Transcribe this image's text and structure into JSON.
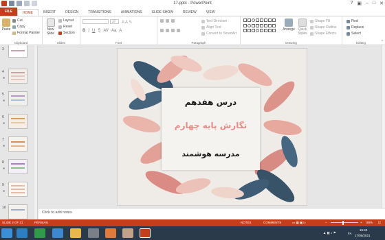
{
  "window": {
    "title": "17.pptx - PowerPoint"
  },
  "tabs": [
    "FILE",
    "HOME",
    "INSERT",
    "DESIGN",
    "TRANSITIONS",
    "ANIMATIONS",
    "SLIDE SHOW",
    "REVIEW",
    "VIEW"
  ],
  "ribbon": {
    "clipboard": {
      "paste": "Paste",
      "cut": "Cut",
      "copy": "Copy",
      "format_painter": "Format Painter",
      "label": "Clipboard"
    },
    "slides": {
      "new_slide": "New Slide",
      "layout": "Layout",
      "reset": "Reset",
      "section": "Section",
      "label": "Slides"
    },
    "font": {
      "label": "Font",
      "size": "27"
    },
    "paragraph": {
      "text_direction": "Text Direction",
      "align_text": "Align Text",
      "convert_smartart": "Convert to SmartArt",
      "label": "Paragraph"
    },
    "drawing": {
      "arrange": "Arrange",
      "quick_styles": "Quick Styles",
      "shape_fill": "Shape Fill",
      "shape_outline": "Shape Outline",
      "shape_effects": "Shape Effects",
      "label": "Drawing"
    },
    "editing": {
      "find": "Find",
      "replace": "Replace",
      "select": "Select",
      "label": "Editing"
    }
  },
  "thumbnails": [
    "3",
    "4",
    "5",
    "6",
    "7",
    "8",
    "9",
    "10"
  ],
  "slide": {
    "line1": "درس هفدهم",
    "line2": "نگارش پایه چهارم",
    "line3": "مدرسه هوشمند"
  },
  "notes": {
    "placeholder": "Click to add notes"
  },
  "status": {
    "slide_of": "SLIDE 2 OF 21",
    "language": "PERSIAN",
    "notes": "NOTES",
    "comments": "COMMENTS",
    "zoom": "89%",
    "zoom_level": 0.45
  },
  "taskbar": {
    "time": "15:40",
    "date": "17/05/2021",
    "lang": "FA"
  },
  "colors": {
    "accent": "#c43e1c",
    "title_pink": "#e98a86",
    "taskbar": "#2b3a4a"
  }
}
